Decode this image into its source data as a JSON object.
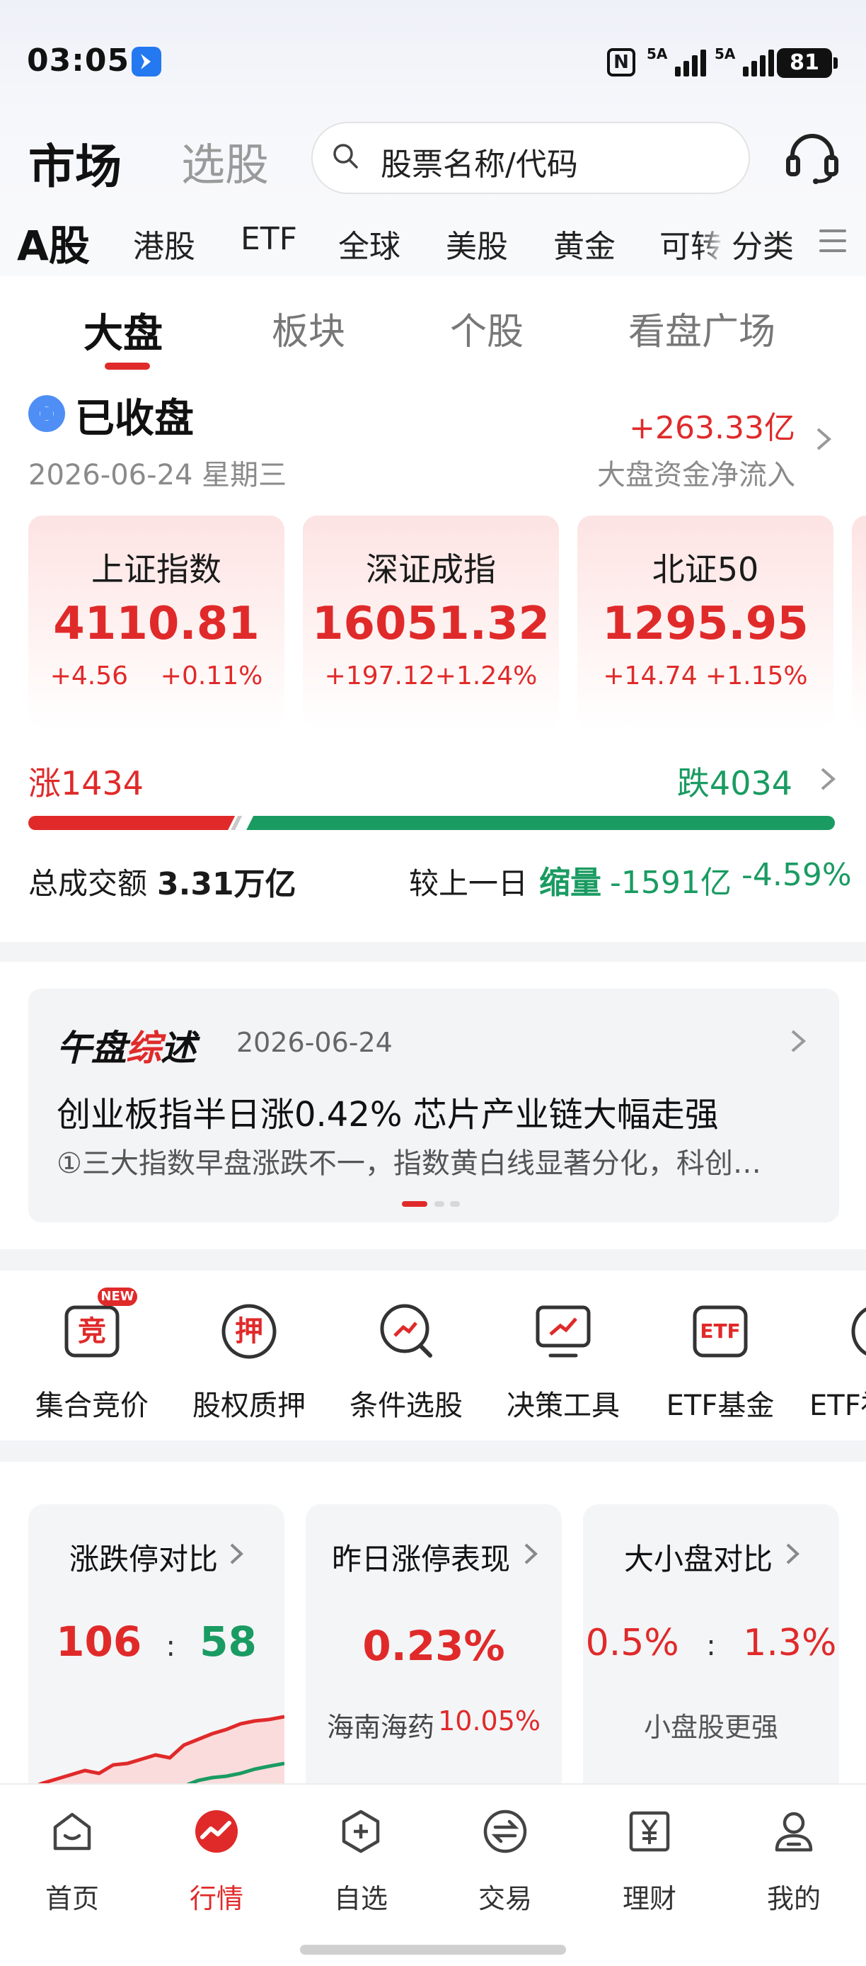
{
  "status_bar": {
    "time": "03:05",
    "nfc": "N",
    "signal_1": "5A",
    "signal_2": "5A",
    "battery": "81"
  },
  "header": {
    "title_market": "市场",
    "title_pick": "选股",
    "search_placeholder": "股票名称/代码"
  },
  "market_tabs": [
    "A股",
    "港股",
    "ETF",
    "全球",
    "美股",
    "黄金",
    "可转",
    "分类"
  ],
  "sub_tabs": [
    "大盘",
    "板块",
    "个股",
    "看盘广场"
  ],
  "market_status": {
    "status": "已收盘",
    "date": "2026-06-24 星期三",
    "net_inflow_value": "+263.33亿",
    "net_inflow_label": "大盘资金净流入"
  },
  "indices": [
    {
      "name": "上证指数",
      "value": "4110.81",
      "change": "+4.56    +0.11%"
    },
    {
      "name": "深证成指",
      "value": "16051.32",
      "change": "+197.12+1.24%"
    },
    {
      "name": "北证50",
      "value": "1295.95",
      "change": "+14.74 +1.15%"
    }
  ],
  "breadth": {
    "rise_label": "涨1434",
    "fall_label": "跌4034",
    "rise": 1434,
    "fall": 4034
  },
  "turnover": {
    "label": "总成交额",
    "value": "3.31万亿",
    "vs_label": "较上一日",
    "shrink_label": "缩量",
    "shrink_amount": "-1591亿",
    "shrink_pct": "-4.59%"
  },
  "news": {
    "logo_a": "午盘",
    "logo_bolt": "综",
    "logo_b": "述",
    "date": "2026-06-24",
    "headline": "创业板指半日涨0.42% 芯片产业链大幅走强",
    "summary": "①三大指数早盘涨跌不一，指数黄白线显著分化，科创…"
  },
  "tools": [
    {
      "label": "集合竞价",
      "glyph": "竞",
      "badge": "NEW"
    },
    {
      "label": "股权质押",
      "glyph": "押"
    },
    {
      "label": "条件选股",
      "glyph": ""
    },
    {
      "label": "决策工具",
      "glyph": ""
    },
    {
      "label": "ETF基金",
      "glyph": "ETF"
    },
    {
      "label": "ETF福",
      "glyph": ""
    }
  ],
  "stats": {
    "limit": {
      "title": "涨跌停对比",
      "up": "106",
      "sep": ":",
      "down": "58"
    },
    "yesterday": {
      "title": "昨日涨停表现",
      "value": "0.23%",
      "stock": "海南海药",
      "stock_pct": "10.05%"
    },
    "cap": {
      "title": "大小盘对比",
      "large": "0.5%",
      "sep": ":",
      "small": "1.3%",
      "note": "小盘股更强"
    }
  },
  "bottom_nav": [
    "首页",
    "行情",
    "自选",
    "交易",
    "理财",
    "我的"
  ],
  "colors": {
    "up": "#e02a2a",
    "down": "#1a9b62",
    "accent_blue": "#2478f0"
  }
}
